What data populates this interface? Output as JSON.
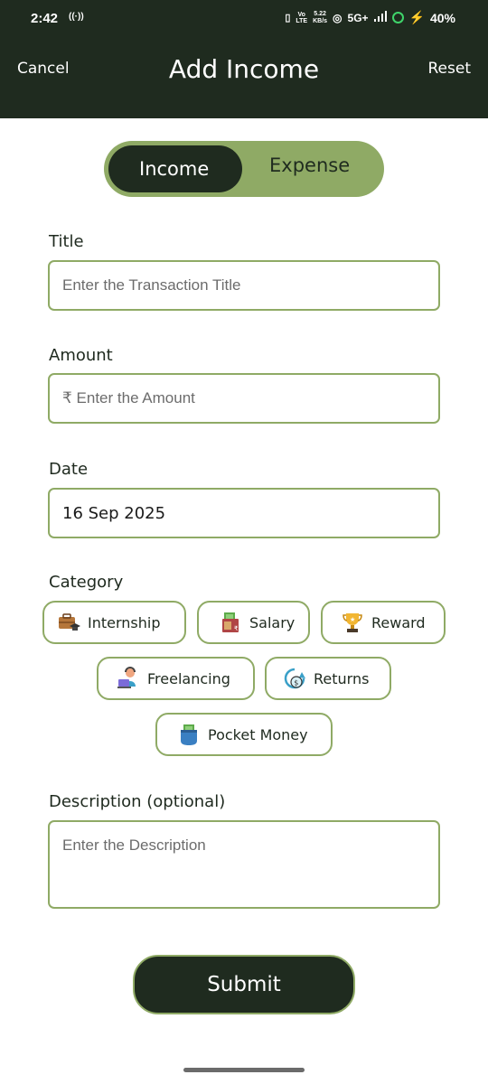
{
  "status_bar": {
    "time": "2:42",
    "speed_value": "5.22",
    "speed_unit": "KB/s",
    "network": "5G+",
    "battery": "40%"
  },
  "header": {
    "cancel_label": "Cancel",
    "title": "Add Income",
    "reset_label": "Reset"
  },
  "type_toggle": {
    "options": [
      "Income",
      "Expense"
    ],
    "selected": "Income"
  },
  "form": {
    "title_label": "Title",
    "title_placeholder": "Enter the Transaction Title",
    "amount_label": "Amount",
    "amount_placeholder": "₹ Enter the Amount",
    "date_label": "Date",
    "date_value": "16 Sep 2025",
    "category_label": "Category",
    "categories": [
      {
        "label": "Internship",
        "icon": "briefcase-graduation-icon"
      },
      {
        "label": "Salary",
        "icon": "salary-money-icon"
      },
      {
        "label": "Reward",
        "icon": "trophy-icon"
      },
      {
        "label": "Freelancing",
        "icon": "freelancer-laptop-icon"
      },
      {
        "label": "Returns",
        "icon": "returns-coin-icon"
      },
      {
        "label": "Pocket Money",
        "icon": "pocket-money-icon"
      }
    ],
    "description_label": "Description (optional)",
    "description_placeholder": "Enter the Description"
  },
  "submit_label": "Submit",
  "colors": {
    "header_bg": "#1f2b1f",
    "accent": "#8faa65",
    "text": "#1f2a1f"
  }
}
